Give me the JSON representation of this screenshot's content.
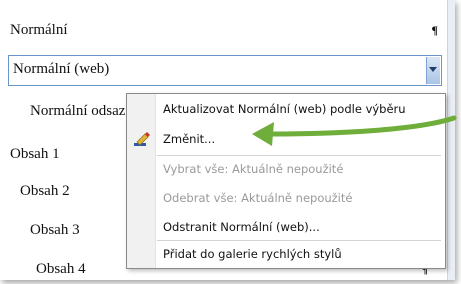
{
  "style_rows": [
    {
      "name": "Normální",
      "mark": "¶"
    },
    {
      "name": "Normální (web)"
    },
    {
      "name": "Normální odsazení"
    },
    {
      "name": "Obsah 1"
    },
    {
      "name": "Obsah 2"
    },
    {
      "name": "Obsah 3"
    },
    {
      "name": "Obsah 4",
      "mark": "¶"
    }
  ],
  "context_menu": {
    "items": [
      {
        "label": "Aktualizovat Normální (web) podle výběru",
        "enabled": true
      },
      {
        "label": "Změnit...",
        "enabled": true,
        "icon": "modify-style-icon"
      },
      {
        "label": "Vybrat vše: Aktuálně nepoužité",
        "enabled": false
      },
      {
        "label": "Odebrat vše: Aktuálně nepoužité",
        "enabled": false
      },
      {
        "label": "Odstranit Normální (web)...",
        "enabled": true
      },
      {
        "label": "Přidat do galerie rychlých stylů",
        "enabled": true
      }
    ]
  },
  "colors": {
    "accent": "#6b95c9",
    "arrow": "#6fae3a"
  }
}
